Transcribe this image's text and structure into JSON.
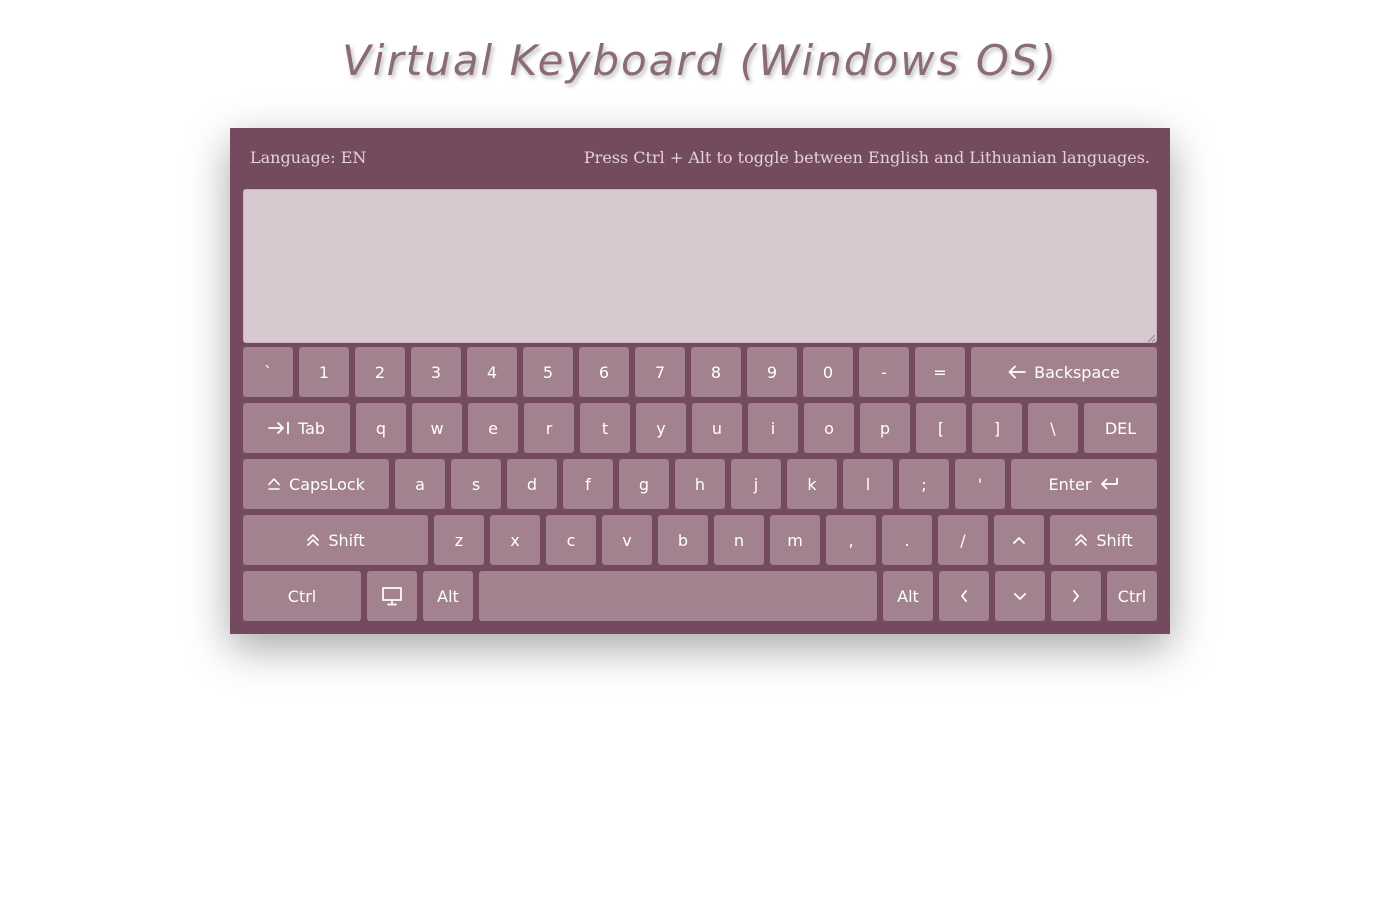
{
  "title": "Virtual Keyboard (Windows OS)",
  "info": {
    "language": "Language: EN",
    "hint": "Press Ctrl + Alt to toggle between English and Lithuanian languages."
  },
  "textarea": {
    "value": ""
  },
  "colors": {
    "panel": "#744a5e",
    "key": "#a2828f",
    "textarea": "#d8c9d0",
    "title": "#8a6b7a"
  },
  "rows": [
    [
      {
        "id": "backtick",
        "label": "`"
      },
      {
        "id": "1",
        "label": "1"
      },
      {
        "id": "2",
        "label": "2"
      },
      {
        "id": "3",
        "label": "3"
      },
      {
        "id": "4",
        "label": "4"
      },
      {
        "id": "5",
        "label": "5"
      },
      {
        "id": "6",
        "label": "6"
      },
      {
        "id": "7",
        "label": "7"
      },
      {
        "id": "8",
        "label": "8"
      },
      {
        "id": "9",
        "label": "9"
      },
      {
        "id": "0",
        "label": "0"
      },
      {
        "id": "minus",
        "label": "-"
      },
      {
        "id": "equals",
        "label": "="
      },
      {
        "id": "backspace",
        "label": "Backspace",
        "icon": "arrow-left-icon"
      }
    ],
    [
      {
        "id": "tab",
        "label": "Tab",
        "icon": "tab-icon"
      },
      {
        "id": "q",
        "label": "q"
      },
      {
        "id": "w",
        "label": "w"
      },
      {
        "id": "e",
        "label": "e"
      },
      {
        "id": "r",
        "label": "r"
      },
      {
        "id": "t",
        "label": "t"
      },
      {
        "id": "y",
        "label": "y"
      },
      {
        "id": "u",
        "label": "u"
      },
      {
        "id": "i",
        "label": "i"
      },
      {
        "id": "o",
        "label": "o"
      },
      {
        "id": "p",
        "label": "p"
      },
      {
        "id": "bracket-left",
        "label": "["
      },
      {
        "id": "bracket-right",
        "label": "]"
      },
      {
        "id": "backslash",
        "label": "\\"
      },
      {
        "id": "del",
        "label": "DEL"
      }
    ],
    [
      {
        "id": "capslock",
        "label": "CapsLock",
        "icon": "capslock-icon"
      },
      {
        "id": "a",
        "label": "a"
      },
      {
        "id": "s",
        "label": "s"
      },
      {
        "id": "d",
        "label": "d"
      },
      {
        "id": "f",
        "label": "f"
      },
      {
        "id": "g",
        "label": "g"
      },
      {
        "id": "h",
        "label": "h"
      },
      {
        "id": "j",
        "label": "j"
      },
      {
        "id": "k",
        "label": "k"
      },
      {
        "id": "l",
        "label": "l"
      },
      {
        "id": "semicolon",
        "label": ";"
      },
      {
        "id": "quote",
        "label": "'"
      },
      {
        "id": "enter",
        "label": "Enter",
        "icon": "enter-icon"
      }
    ],
    [
      {
        "id": "shift-left",
        "label": "Shift",
        "icon": "shift-icon"
      },
      {
        "id": "z",
        "label": "z"
      },
      {
        "id": "x",
        "label": "x"
      },
      {
        "id": "c",
        "label": "c"
      },
      {
        "id": "v",
        "label": "v"
      },
      {
        "id": "b",
        "label": "b"
      },
      {
        "id": "n",
        "label": "n"
      },
      {
        "id": "m",
        "label": "m"
      },
      {
        "id": "comma",
        "label": ","
      },
      {
        "id": "period",
        "label": "."
      },
      {
        "id": "slash",
        "label": "/"
      },
      {
        "id": "arrow-up",
        "label": "",
        "icon": "chevron-up-icon"
      },
      {
        "id": "shift-right",
        "label": "Shift",
        "icon": "shift-icon"
      }
    ],
    [
      {
        "id": "ctrl-left",
        "label": "Ctrl"
      },
      {
        "id": "win",
        "label": "",
        "icon": "monitor-icon"
      },
      {
        "id": "alt-left",
        "label": "Alt"
      },
      {
        "id": "space",
        "label": ""
      },
      {
        "id": "alt-right",
        "label": "Alt"
      },
      {
        "id": "arrow-left",
        "label": "",
        "icon": "chevron-left-icon"
      },
      {
        "id": "arrow-down",
        "label": "",
        "icon": "chevron-down-icon"
      },
      {
        "id": "arrow-right",
        "label": "",
        "icon": "chevron-right-icon"
      },
      {
        "id": "ctrl-right",
        "label": "Ctrl"
      }
    ]
  ]
}
